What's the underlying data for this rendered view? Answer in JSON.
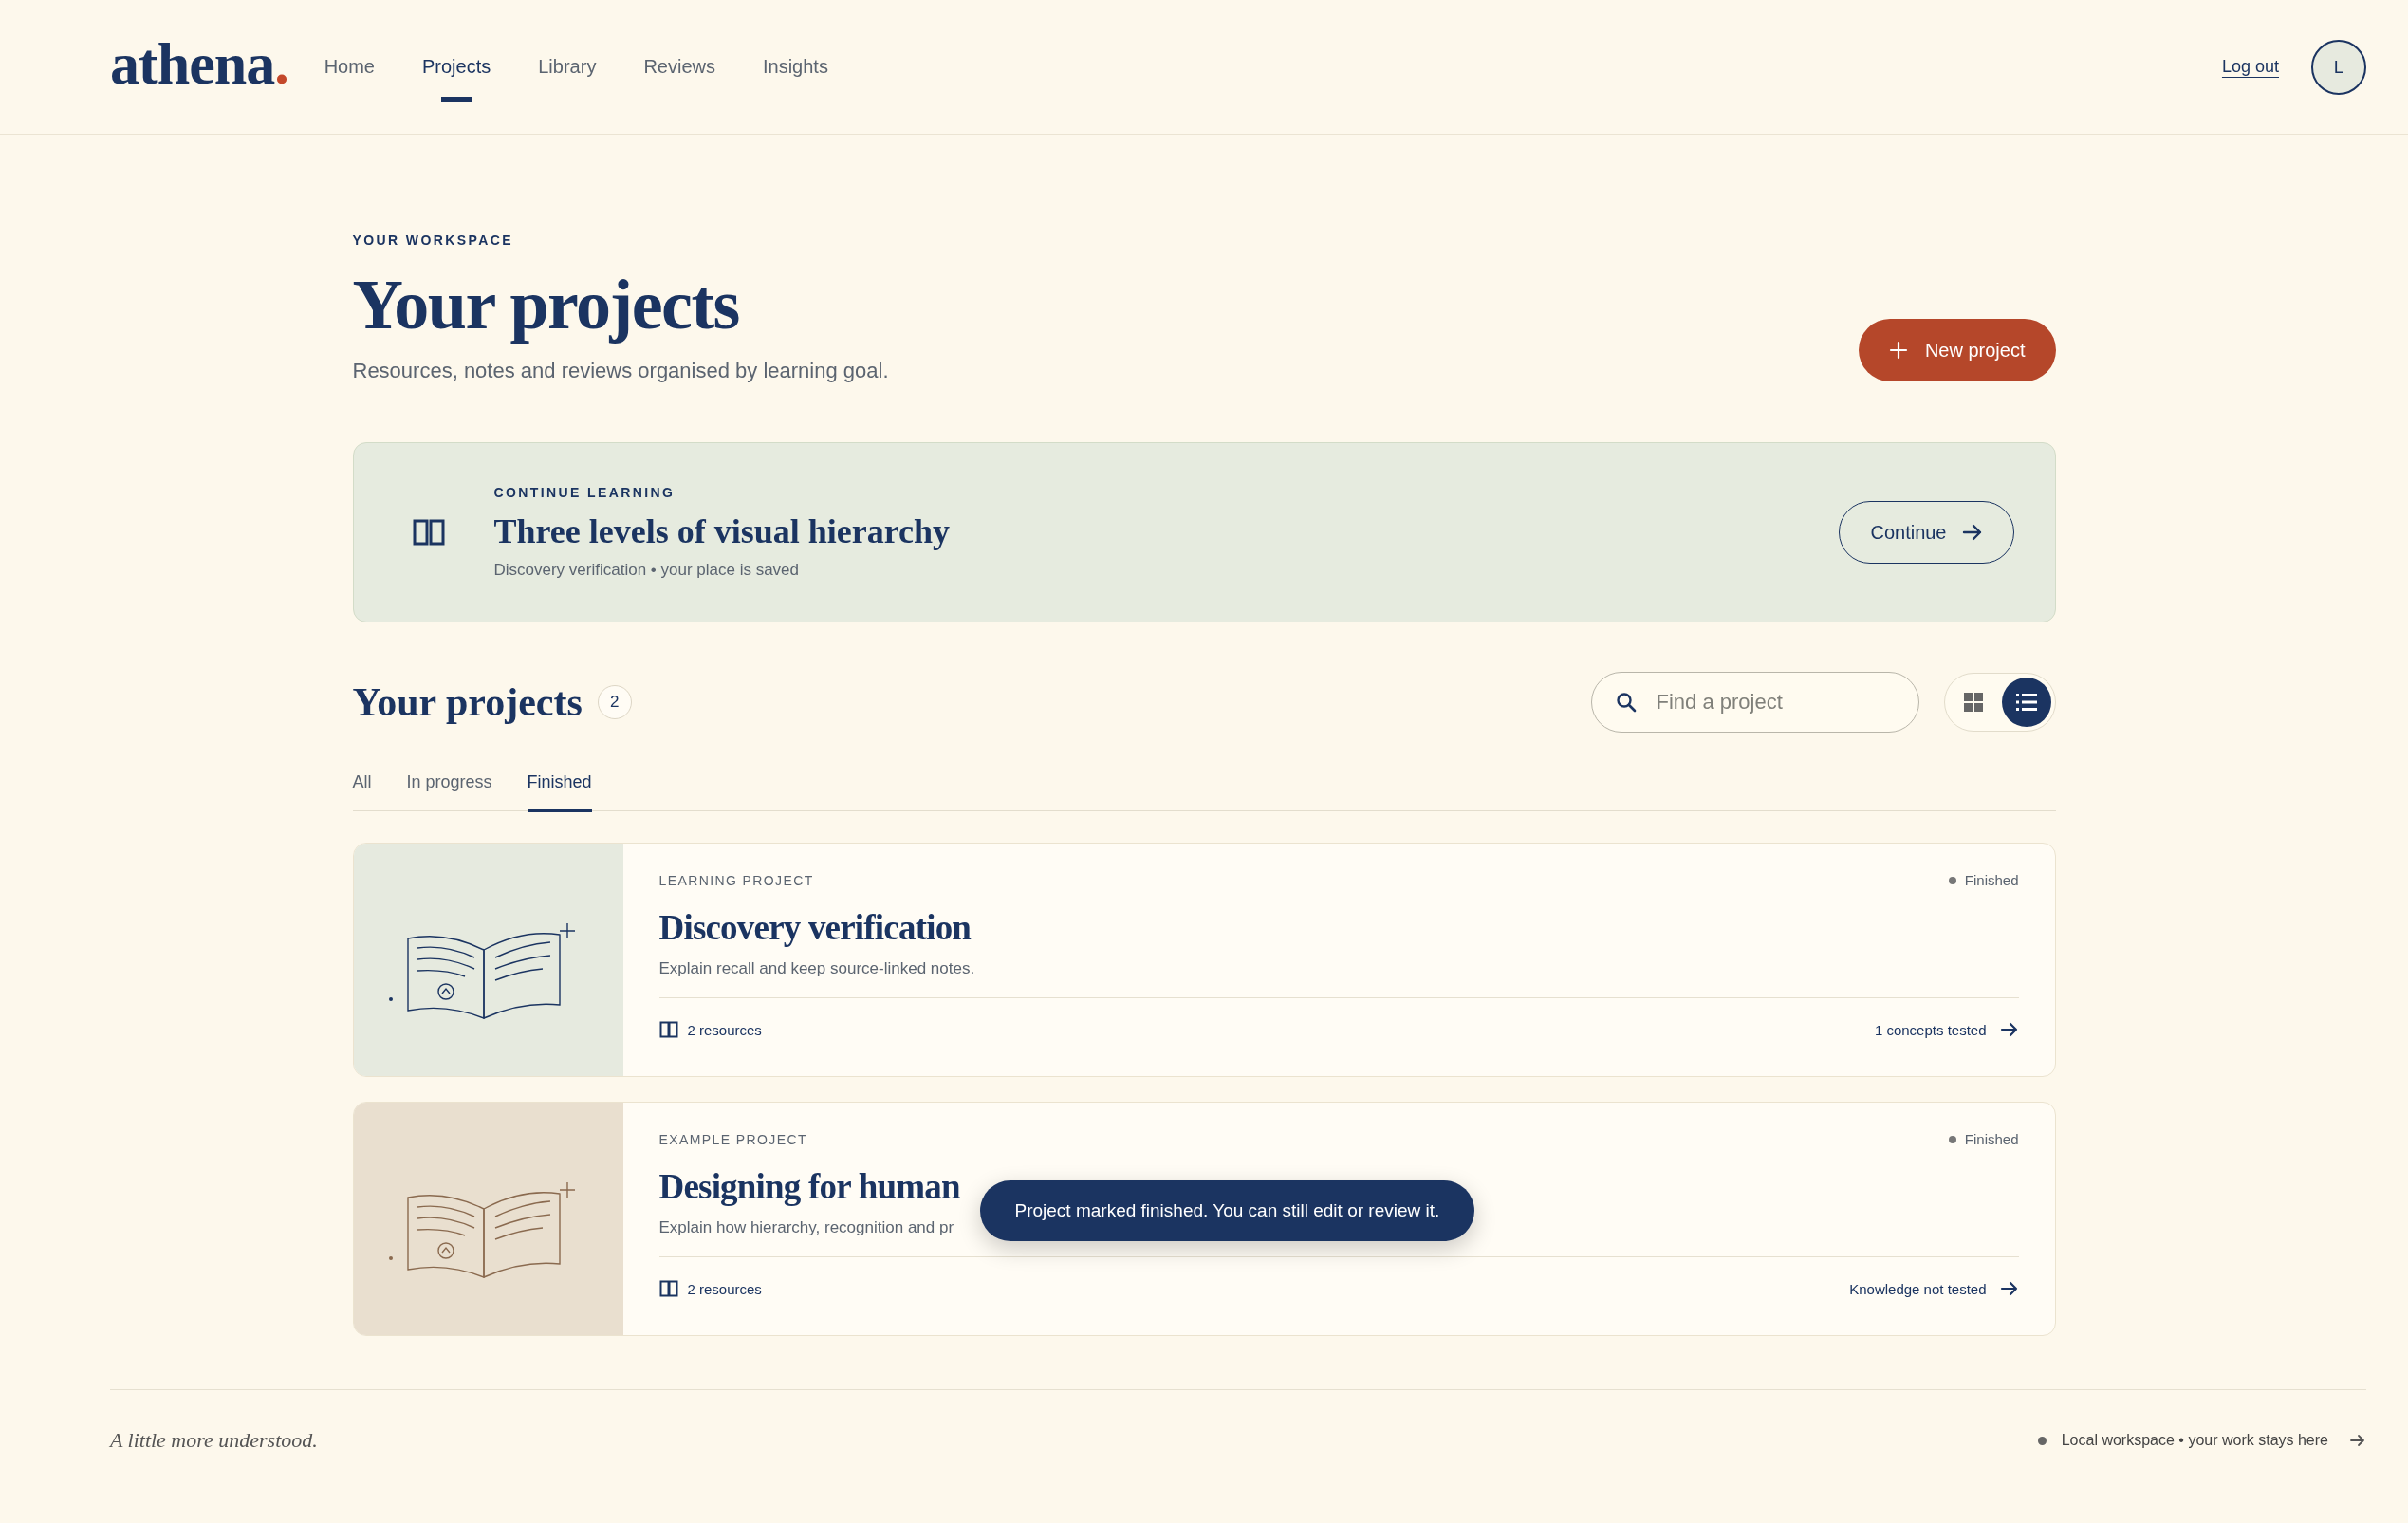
{
  "header": {
    "logo": "athena",
    "logo_dot": ".",
    "nav": [
      {
        "label": "Home",
        "selected": false
      },
      {
        "label": "Projects",
        "selected": true
      },
      {
        "label": "Library",
        "selected": false
      },
      {
        "label": "Reviews",
        "selected": false
      },
      {
        "label": "Insights",
        "selected": false
      }
    ],
    "logout": "Log out",
    "avatar": "L"
  },
  "hero": {
    "eyebrow": "YOUR WORKSPACE",
    "title": "Your projects",
    "subtitle": "Resources, notes and reviews organised by learning goal.",
    "new_button": "New project"
  },
  "continue_card": {
    "eyebrow": "CONTINUE LEARNING",
    "title": "Three levels of visual hierarchy",
    "meta": "Discovery verification • your place is saved",
    "button": "Continue"
  },
  "projects": {
    "title": "Your projects",
    "count": "2",
    "search": {
      "placeholder": "Find a project"
    },
    "views": [
      {
        "kind": "grid",
        "selected": false
      },
      {
        "kind": "list",
        "selected": true
      }
    ],
    "tabs": [
      {
        "label": "All",
        "selected": false
      },
      {
        "label": "In progress",
        "selected": false
      },
      {
        "label": "Finished",
        "selected": true
      }
    ],
    "items": [
      {
        "kind": "learning",
        "type": "LEARNING PROJECT",
        "status": "Finished",
        "title": "Discovery verification",
        "description": "Explain recall and keep source-linked notes.",
        "resources": "2 resources",
        "progress": "1 concepts tested"
      },
      {
        "kind": "example",
        "type": "EXAMPLE PROJECT",
        "status": "Finished",
        "title": "Designing for human",
        "description": "Explain how hierarchy, recognition and pr",
        "resources": "2 resources",
        "progress": "Knowledge not tested"
      }
    ]
  },
  "toast": "Project marked finished. You can still edit or review it.",
  "footer": {
    "tagline": "A little more understood.",
    "note": "Local workspace • your work stays here"
  }
}
